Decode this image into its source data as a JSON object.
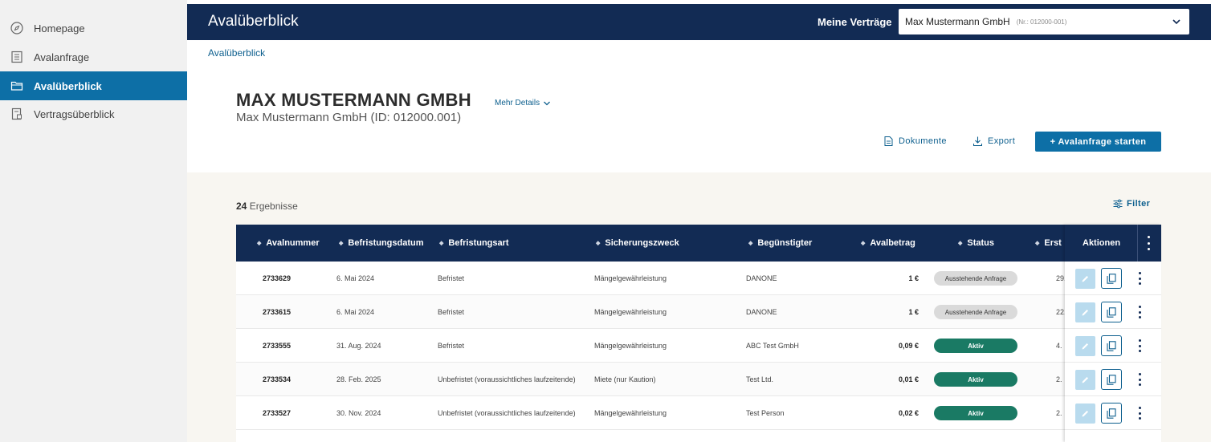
{
  "sidebar": {
    "items": [
      {
        "label": "Homepage",
        "icon": "compass-icon",
        "active": false
      },
      {
        "label": "Avalanfrage",
        "icon": "list-icon",
        "active": false
      },
      {
        "label": "Avalüberblick",
        "icon": "folder-icon",
        "active": true
      },
      {
        "label": "Vertragsüberblick",
        "icon": "contract-icon",
        "active": false
      }
    ]
  },
  "header": {
    "title": "Avalüberblick",
    "contracts_label": "Meine Verträge",
    "contract_selected": "Max Mustermann GmbH",
    "contract_nr": "(Nr.: 012000-001)"
  },
  "breadcrumb": "Avalüberblick",
  "company": {
    "title": "MAX MUSTERMANN GMBH",
    "more_details": "Mehr Details",
    "subtitle": "Max Mustermann GmbH (ID: 012000.001)"
  },
  "actions": {
    "documents": "Dokumente",
    "export": "Export",
    "start_request": "+ Avalanfrage starten",
    "filter": "Filter"
  },
  "results": {
    "count": "24",
    "label": "Ergebnisse"
  },
  "table": {
    "columns": [
      "Avalnummer",
      "Befristungsdatum",
      "Befristungsart",
      "Sicherungszweck",
      "Begünstigter",
      "Avalbetrag",
      "Status",
      "Erst"
    ],
    "actions_header": "Aktionen",
    "rows": [
      {
        "nr": "2733629",
        "date": "6. Mai 2024",
        "type": "Befristet",
        "purpose": "Mängelgewährleistung",
        "beneficiary": "DANONE",
        "amount": "1 €",
        "status": "Ausstehende Anfrage",
        "status_kind": "pending",
        "created": "29."
      },
      {
        "nr": "2733615",
        "date": "6. Mai 2024",
        "type": "Befristet",
        "purpose": "Mängelgewährleistung",
        "beneficiary": "DANONE",
        "amount": "1 €",
        "status": "Ausstehende Anfrage",
        "status_kind": "pending",
        "created": "22."
      },
      {
        "nr": "2733555",
        "date": "31. Aug. 2024",
        "type": "Befristet",
        "purpose": "Mängelgewährleistung",
        "beneficiary": "ABC Test GmbH",
        "amount": "0,09 €",
        "status": "Aktiv",
        "status_kind": "active",
        "created": "4."
      },
      {
        "nr": "2733534",
        "date": "28. Feb. 2025",
        "type": "Unbefristet (voraussichtliches laufzeitende)",
        "purpose": "Miete (nur Kaution)",
        "beneficiary": "Test Ltd.",
        "amount": "0,01 €",
        "status": "Aktiv",
        "status_kind": "active",
        "created": "2."
      },
      {
        "nr": "2733527",
        "date": "30. Nov. 2024",
        "type": "Unbefristet (voraussichtliches laufzeitende)",
        "purpose": "Mängelgewährleistung",
        "beneficiary": "Test Person",
        "amount": "0,02 €",
        "status": "Aktiv",
        "status_kind": "active",
        "created": "2."
      }
    ]
  },
  "colors": {
    "navy": "#122b54",
    "accent": "#0d6fa6",
    "active_status": "#1a7a64",
    "pending_status": "#dadada"
  }
}
